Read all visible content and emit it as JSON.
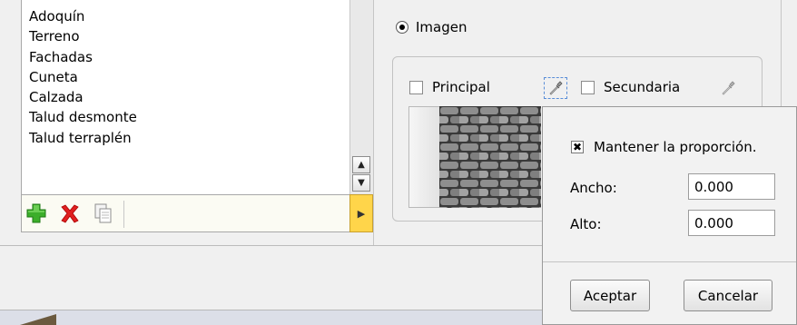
{
  "materials": {
    "items": [
      "Adoquín",
      "Terreno",
      "Fachadas",
      "Cuneta",
      "Calzada",
      "Talud desmonte",
      "Talud terraplén"
    ]
  },
  "toolbar": {
    "add_icon": "add-icon",
    "delete_icon": "delete-icon",
    "copy_icon": "copy-icon"
  },
  "source": {
    "image_label": "Imagen",
    "image_selected": true
  },
  "textures": {
    "principal_label": "Principal",
    "secundaria_label": "Secundaria",
    "principal_checked": false,
    "secundaria_checked": false
  },
  "popup": {
    "keep_ratio_label": "Mantener la proporción.",
    "keep_ratio_checked": true,
    "width_label": "Ancho:",
    "width_value": "0.000",
    "height_label": "Alto:",
    "height_value": "0.000",
    "accept_label": "Aceptar",
    "cancel_label": "Cancelar"
  },
  "colors": {
    "expand_button": "#ffd54a",
    "add_icon": "#3cae2a",
    "delete_icon": "#e02020"
  }
}
